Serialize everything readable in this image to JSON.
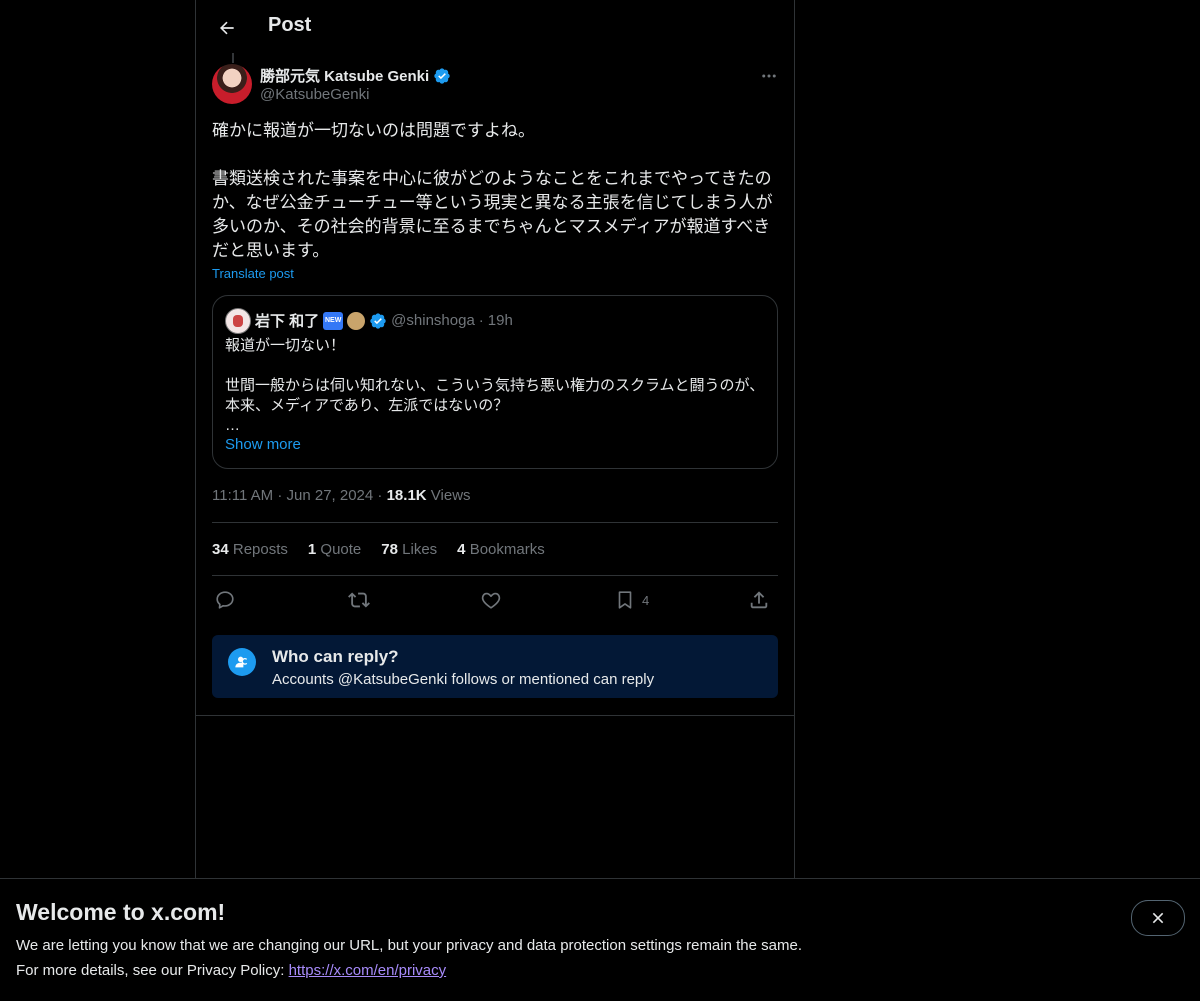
{
  "header": {
    "title": "Post"
  },
  "post": {
    "author_name": "勝部元気 Katsube Genki",
    "author_handle": "@KatsubeGenki",
    "text": "確かに報道が一切ないのは問題ですよね。\n\n書類送検された事案を中心に彼がどのようなことをこれまでやってきたのか、なぜ公金チューチュー等という現実と異なる主張を信じてしまう人が多いのか、その社会的背景に至るまでちゃんとマスメディアが報道すべきだと思います。",
    "translate_label": "Translate post",
    "time": "11:11 AM",
    "date": "Jun 27, 2024",
    "views_count": "18.1K",
    "views_label": "Views",
    "separator": "·"
  },
  "quote": {
    "author_name": "岩下 和了",
    "author_handle": "@shinshoga",
    "separator": "·",
    "time": "19h",
    "text": "報道が一切ない！\n\n世間一般からは伺い知れない、こういう気持ち悪い権力のスクラムと闘うのが、本来、メディアであり、左派ではないの？\n…",
    "show_more": "Show more",
    "badge_new_text": "NEW"
  },
  "stats": [
    {
      "count": "34",
      "label": "Reposts"
    },
    {
      "count": "1",
      "label": "Quote"
    },
    {
      "count": "78",
      "label": "Likes"
    },
    {
      "count": "4",
      "label": "Bookmarks"
    }
  ],
  "actions": {
    "bookmark_count": "4",
    "icons": [
      "reply-icon",
      "repost-icon",
      "like-icon",
      "bookmark-icon",
      "share-icon"
    ]
  },
  "reply_restriction": {
    "title": "Who can reply?",
    "subtitle": "Accounts @KatsubeGenki follows or mentioned can reply"
  },
  "banner": {
    "title": "Welcome to x.com!",
    "line1": "We are letting you know that we are changing our URL, but your privacy and data protection settings remain the same.",
    "line2_prefix": "For more details, see our Privacy Policy: ",
    "link": "https://x.com/en/privacy"
  },
  "colors": {
    "background": "#000000",
    "accent": "#1d9bf0",
    "muted_text": "#71767b",
    "border": "#2f3336",
    "reply_box_bg": "#031836",
    "link_visited": "#a78bfa"
  }
}
